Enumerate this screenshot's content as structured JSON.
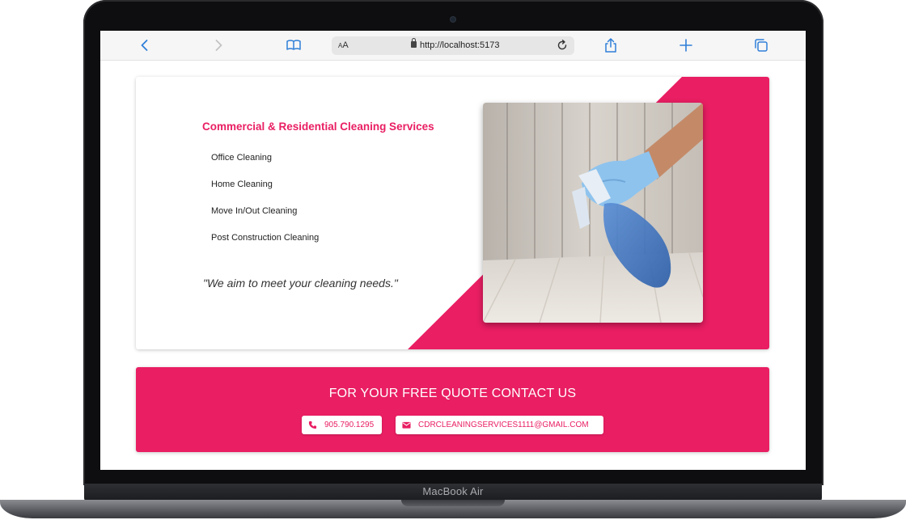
{
  "browser": {
    "reader_label_small": "A",
    "reader_label_large": "A",
    "url": "http://localhost:5173"
  },
  "hero": {
    "title": "Commercial & Residential Cleaning Services",
    "services": [
      "Office Cleaning",
      "Home Cleaning",
      "Move In/Out Cleaning",
      "Post Construction Cleaning"
    ],
    "tagline": "\"We aim to meet your cleaning needs.\""
  },
  "contact": {
    "title": "FOR YOUR FREE QUOTE CONTACT US",
    "phone": "905.790.1295",
    "email": "CDRCLEANINGSERVICES1111@GMAIL.COM"
  },
  "device": {
    "model": "MacBook Air"
  },
  "colors": {
    "accent": "#e91e63",
    "browser_blue": "#2f7fd8"
  },
  "icons": [
    "chevron-left-icon",
    "chevron-right-icon",
    "book-icon",
    "lock-icon",
    "reload-icon",
    "share-icon",
    "plus-icon",
    "tabs-icon",
    "phone-icon",
    "mail-icon"
  ]
}
